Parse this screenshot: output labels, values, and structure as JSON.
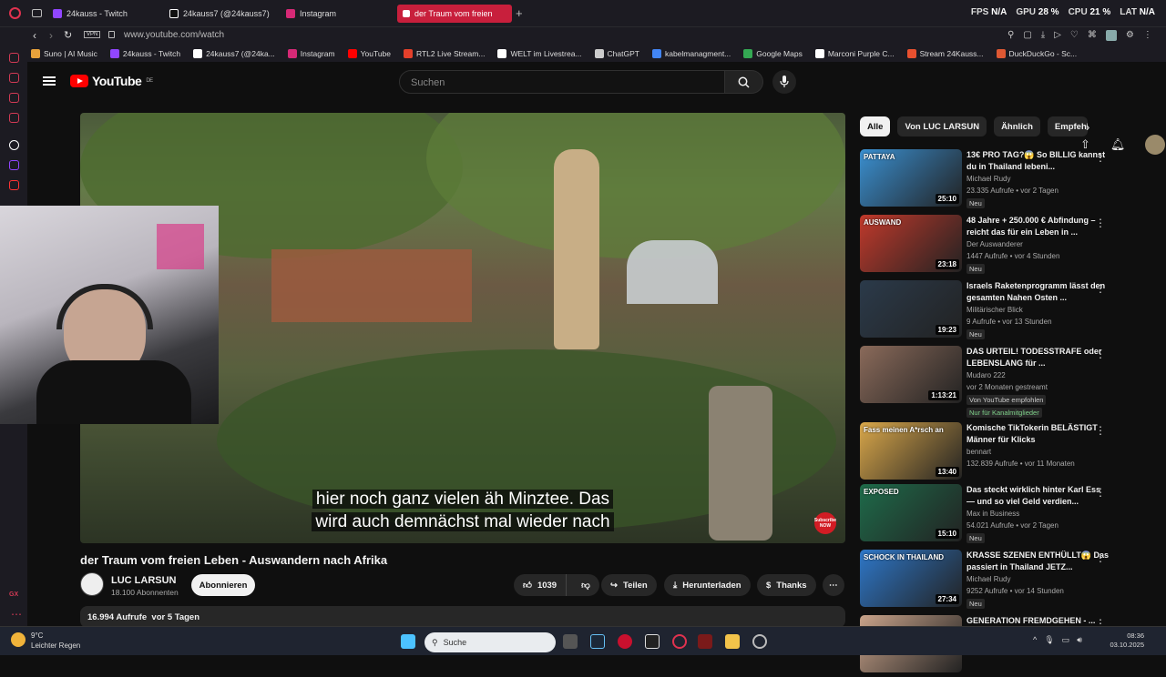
{
  "browser": {
    "tabs": [
      {
        "label": "24kauss - Twitch"
      },
      {
        "label": "24kauss7 (@24kauss7)"
      },
      {
        "label": "Instagram"
      },
      {
        "label": "der Traum vom freien"
      }
    ],
    "perf": {
      "fps_label": "FPS",
      "fps": "N/A",
      "gpu_label": "GPU",
      "gpu": "28 %",
      "cpu_label": "CPU",
      "cpu": "21 %",
      "lat_label": "LAT",
      "lat": "N/A"
    },
    "url": "www.youtube.com/watch",
    "bookmarks": [
      {
        "label": "Suno | AI Music",
        "color": "#e8a23b"
      },
      {
        "label": "24kauss - Twitch",
        "color": "#9146ff"
      },
      {
        "label": "24kauss7 (@24ka...",
        "color": "#ffffff"
      },
      {
        "label": "Instagram",
        "color": "#d62976"
      },
      {
        "label": "YouTube",
        "color": "#ff0000"
      },
      {
        "label": "RTL2 Live Stream...",
        "color": "#e4402b"
      },
      {
        "label": "WELT im Livestrea...",
        "color": "#ffffff"
      },
      {
        "label": "ChatGPT",
        "color": "#cccccc"
      },
      {
        "label": "kabelmanagment...",
        "color": "#4285f4"
      },
      {
        "label": "Google Maps",
        "color": "#34a853"
      },
      {
        "label": "Marconi Purple C...",
        "color": "#ffffff"
      },
      {
        "label": "Stream 24Kauss...",
        "color": "#e8502f"
      },
      {
        "label": "DuckDuckGo - Sc...",
        "color": "#de5833"
      }
    ]
  },
  "youtube": {
    "logo": "YouTube",
    "region": "DE",
    "search_placeholder": "Suchen",
    "caption_line1": "hier noch ganz vielen äh Minztee. Das",
    "caption_line2": "wird auch demnächst mal wieder nach",
    "subscribe_overlay": "Subscribe NOW",
    "video_title": "der Traum vom freien Leben - Auswandern nach Afrika",
    "channel": "LUC LARSUN",
    "subscribers": "18.100 Abonnenten",
    "subscribe_button": "Abonnieren",
    "likes": "1039",
    "share": "Teilen",
    "download": "Herunterladen",
    "thanks": "Thanks",
    "views": "16.994 Aufrufe",
    "age": "vor 5 Tagen",
    "chips": [
      "Alle",
      "Von LUC LARSUN",
      "Ähnlich",
      "Empfehl"
    ],
    "recommendations": [
      {
        "title": "13€ PRO TAG?😱 So BILLIG kannst du in Thailand lebeni...",
        "channel": "Michael Rudy",
        "meta": "23.335 Aufrufe • vor 2 Tagen",
        "badge": "Neu",
        "duration": "25:10",
        "thumb_color": "#3a8fd0",
        "thumb_text": "PATTAYA"
      },
      {
        "title": "48 Jahre + 250.000 € Abfindung – reicht das für ein Leben in ...",
        "channel": "Der Auswanderer",
        "meta": "1447 Aufrufe • vor 4 Stunden",
        "badge": "Neu",
        "duration": "23:18",
        "thumb_color": "#c0392b",
        "thumb_text": "AUSWAND"
      },
      {
        "title": "Israels Raketenprogramm lässt den gesamten Nahen Osten ...",
        "channel": "Militärischer Blick",
        "meta": "9 Aufrufe • vor 13 Stunden",
        "badge": "Neu",
        "duration": "19:23",
        "thumb_color": "#2b3a4a",
        "thumb_text": ""
      },
      {
        "title": "DAS URTEIL! TODESSTRAFE oder LEBENSLANG für ...",
        "channel": "Mudaro 222",
        "meta": "vor 2 Monaten gestreamt",
        "badge": "Von YouTube empfohlen",
        "badge2": "Nur für Kanalmitglieder",
        "duration": "1:13:21",
        "thumb_color": "#8a6a5a",
        "thumb_text": ""
      },
      {
        "title": "Komische TikTokerin BELÄSTIGT Männer für Klicks",
        "channel": "bennart",
        "meta": "132.839 Aufrufe • vor 11 Monaten",
        "badge": "",
        "duration": "13:40",
        "thumb_color": "#d9a74a",
        "thumb_text": "Fass meinen A*rsch an"
      },
      {
        "title": "Das steckt wirklich hinter Karl Ess — und so viel Geld verdien...",
        "channel": "Max in Business",
        "meta": "54.021 Aufrufe • vor 2 Tagen",
        "badge": "Neu",
        "duration": "15:10",
        "thumb_color": "#1e6b4a",
        "thumb_text": "EXPOSED"
      },
      {
        "title": "KRASSE SZENEN ENTHÜLLT😱 Das passiert in Thailand JETZ...",
        "channel": "Michael Rudy",
        "meta": "9252 Aufrufe • vor 14 Stunden",
        "badge": "Neu",
        "duration": "27:34",
        "thumb_color": "#2e77c8",
        "thumb_text": "SCHOCK IN THAILAND"
      },
      {
        "title": "GENERATION FREMDGEHEN - ...",
        "channel": "",
        "meta": "",
        "badge": "",
        "duration": "",
        "thumb_color": "#c9a38a",
        "thumb_text": ""
      }
    ]
  },
  "taskbar": {
    "temp": "9°C",
    "weather": "Leichter Regen",
    "search": "Suche",
    "time": "08:36",
    "date": "03.10.2025"
  }
}
